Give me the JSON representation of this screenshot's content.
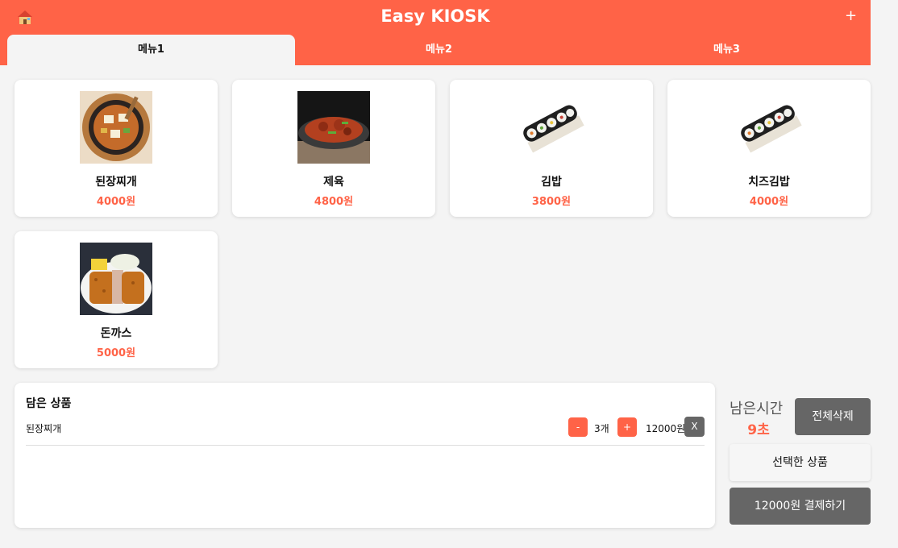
{
  "header": {
    "title": "Easy KIOSK",
    "add_symbol": "+",
    "home_icon": "home-icon"
  },
  "tabs": [
    {
      "label": "메뉴1",
      "active": true
    },
    {
      "label": "메뉴2",
      "active": false
    },
    {
      "label": "메뉴3",
      "active": false
    }
  ],
  "menu": [
    {
      "name": "된장찌개",
      "price": "4000원",
      "image": "doenjang-jjigae-photo"
    },
    {
      "name": "제육",
      "price": "4800원",
      "image": "jeyuk-photo"
    },
    {
      "name": "김밥",
      "price": "3800원",
      "image": "gimbap-photo"
    },
    {
      "name": "치즈김밥",
      "price": "4000원",
      "image": "cheese-gimbap-photo"
    },
    {
      "name": "돈까스",
      "price": "5000원",
      "image": "donkatsu-photo"
    }
  ],
  "cart": {
    "title": "담은 상품",
    "items": [
      {
        "name": "된장찌개",
        "minus": "-",
        "qty": "3개",
        "plus": "+",
        "price": "12000원",
        "remove": "X"
      }
    ]
  },
  "timer": {
    "label": "남은시간",
    "value": "9초"
  },
  "actions": {
    "clear_all": "전체삭제",
    "selected": "선택한 상품",
    "pay": "12000원 결제하기"
  },
  "colors": {
    "accent": "#ff6347",
    "dark_button": "#666666",
    "background": "#f4f4f4"
  }
}
